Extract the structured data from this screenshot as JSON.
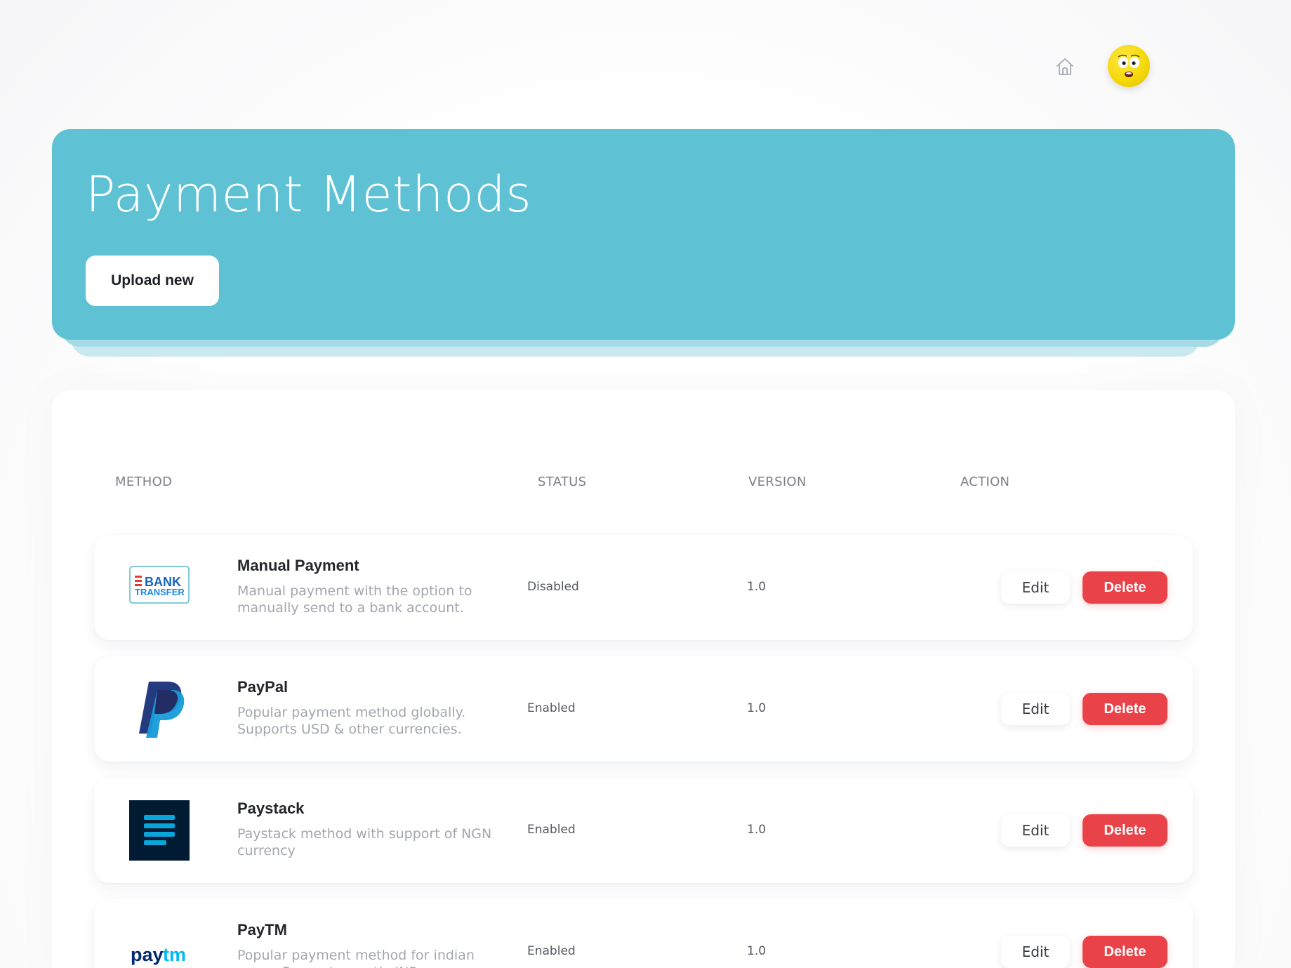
{
  "header": {
    "home_icon": "home-icon",
    "avatar_icon": "emoji-avatar"
  },
  "hero": {
    "title": "Payment Methods",
    "upload_label": "Upload new"
  },
  "table": {
    "columns": [
      "METHOD",
      "STATUS",
      "VERSION",
      "ACTION"
    ],
    "rows": [
      {
        "name": "Manual Payment",
        "description": "Manual payment with the option to manually send to a bank account.",
        "status": "Disabled",
        "version": "1.0",
        "logo": "bank-transfer-logo",
        "logo_text_1": "BANK",
        "logo_text_2": "TRANSFER",
        "edit_label": "Edit",
        "delete_label": "Delete"
      },
      {
        "name": "PayPal",
        "description": "Popular payment method globally. Supports USD & other currencies.",
        "status": "Enabled",
        "version": "1.0",
        "logo": "paypal-logo",
        "edit_label": "Edit",
        "delete_label": "Delete"
      },
      {
        "name": "Paystack",
        "description": "Paystack method with support of NGN currency",
        "status": "Enabled",
        "version": "1.0",
        "logo": "paystack-logo",
        "edit_label": "Edit",
        "delete_label": "Delete"
      },
      {
        "name": "PayTM",
        "description": "Popular payment method for indian users. Supports mostly INR",
        "status": "Enabled",
        "version": "1.0",
        "logo": "paytm-logo",
        "logo_text_1": "pay",
        "logo_text_2": "tm",
        "edit_label": "Edit",
        "delete_label": "Delete"
      }
    ]
  },
  "colors": {
    "hero": "#5fc1d4",
    "delete": "#ea4249",
    "paypal_dark": "#253b80",
    "paypal_light": "#179bd7",
    "paystack": "#011b33",
    "paystack_bars": "#09a5db",
    "paytm_dark": "#002970",
    "paytm_light": "#00baf2",
    "bank_red": "#e53935",
    "bank_blue": "#1565c0"
  }
}
